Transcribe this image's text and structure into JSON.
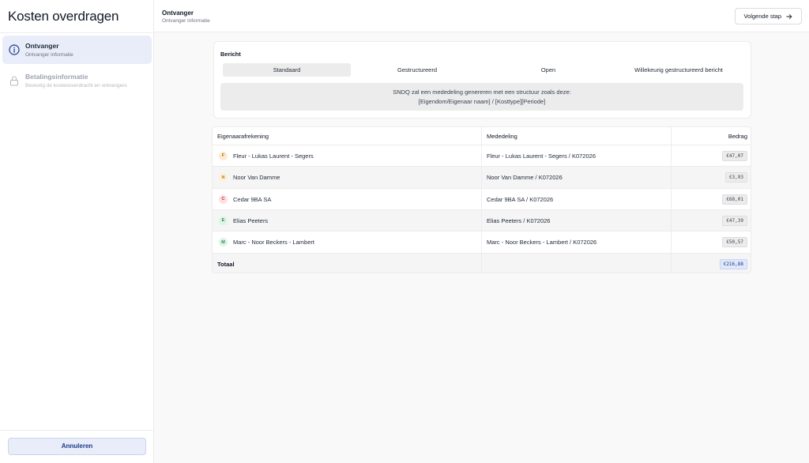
{
  "sidebar": {
    "title": "Kosten overdragen",
    "steps": [
      {
        "title": "Ontvanger",
        "subtitle": "Ontvanger informatie",
        "icon": "info-icon",
        "state": "active"
      },
      {
        "title": "Betalingsinformatie",
        "subtitle": "Bevestig de kostenoverdracht en ontvangers",
        "icon": "lock-icon",
        "state": "disabled"
      }
    ],
    "cancel_label": "Annuleren"
  },
  "header": {
    "title": "Ontvanger",
    "subtitle": "Ontvanger informatie",
    "next_label": "Volgende stap",
    "next_icon": "arrow-right-icon"
  },
  "message": {
    "title": "Bericht",
    "tabs": [
      "Standaard",
      "Gestructureerd",
      "Open",
      "Willekeurig gestructureerd bericht"
    ],
    "active_tab": "Standaard",
    "info_line1": "SNDQ zal een mededeling genereren met een structuur zoals deze:",
    "info_line2": "[Eigendom/Eigenaar naam] / [Kosttype][Periode]"
  },
  "table": {
    "headers": {
      "owner": "Eigenaarafrekening",
      "message": "Mededeling",
      "amount": "Bedrag"
    },
    "rows": [
      {
        "initial": "F",
        "name": "Fleur - Lukas Laurent - Segers",
        "message": "Fleur - Lukas Laurent - Segers / K072026",
        "amount": "€47,07",
        "avatar_bg": "#fdebd3",
        "avatar_fg": "#c2670f"
      },
      {
        "initial": "N",
        "name": "Noor Van Damme",
        "message": "Noor Van Damme / K072026",
        "amount": "€3,93",
        "avatar_bg": "#fdf1d6",
        "avatar_fg": "#b7791f"
      },
      {
        "initial": "C",
        "name": "Cedar 9BA SA",
        "message": "Cedar 9BA SA / K072026",
        "amount": "€68,01",
        "avatar_bg": "#fde0e0",
        "avatar_fg": "#c53030"
      },
      {
        "initial": "E",
        "name": "Elias Peeters",
        "message": "Elias Peeters / K072026",
        "amount": "€47,39",
        "avatar_bg": "#dcf5e3",
        "avatar_fg": "#2f855a"
      },
      {
        "initial": "M",
        "name": "Marc - Noor Beckers - Lambert",
        "message": "Marc - Noor Beckers - Lambert / K072026",
        "amount": "€50,57",
        "avatar_bg": "#dcf5e3",
        "avatar_fg": "#2f855a"
      }
    ],
    "total_label": "Totaal",
    "total_amount": "€216,88"
  }
}
